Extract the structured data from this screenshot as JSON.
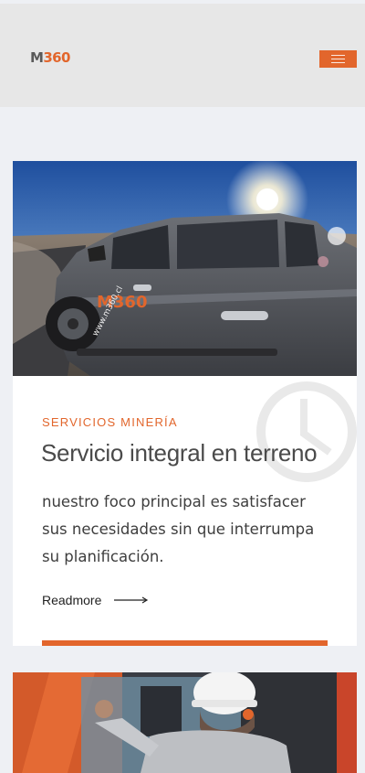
{
  "header": {
    "logo_m": "M",
    "logo_n": "360",
    "menu_button": "menu"
  },
  "card": {
    "image_alt": "Camioneta M360",
    "truck_logo": "M360",
    "truck_url": "www.m360.cl",
    "category": "SERVICIOS MINERÍA",
    "title": "Servicio integral en terreno",
    "description": "nuestro foco principal es satisfacer sus necesidades sin que interrumpa su planificación.",
    "readmore": "Readmore",
    "watermark_icon": "clock-icon"
  },
  "colors": {
    "accent": "#e2662c",
    "header_bg": "#e7e7e7",
    "page_bg": "#eef0f4"
  }
}
